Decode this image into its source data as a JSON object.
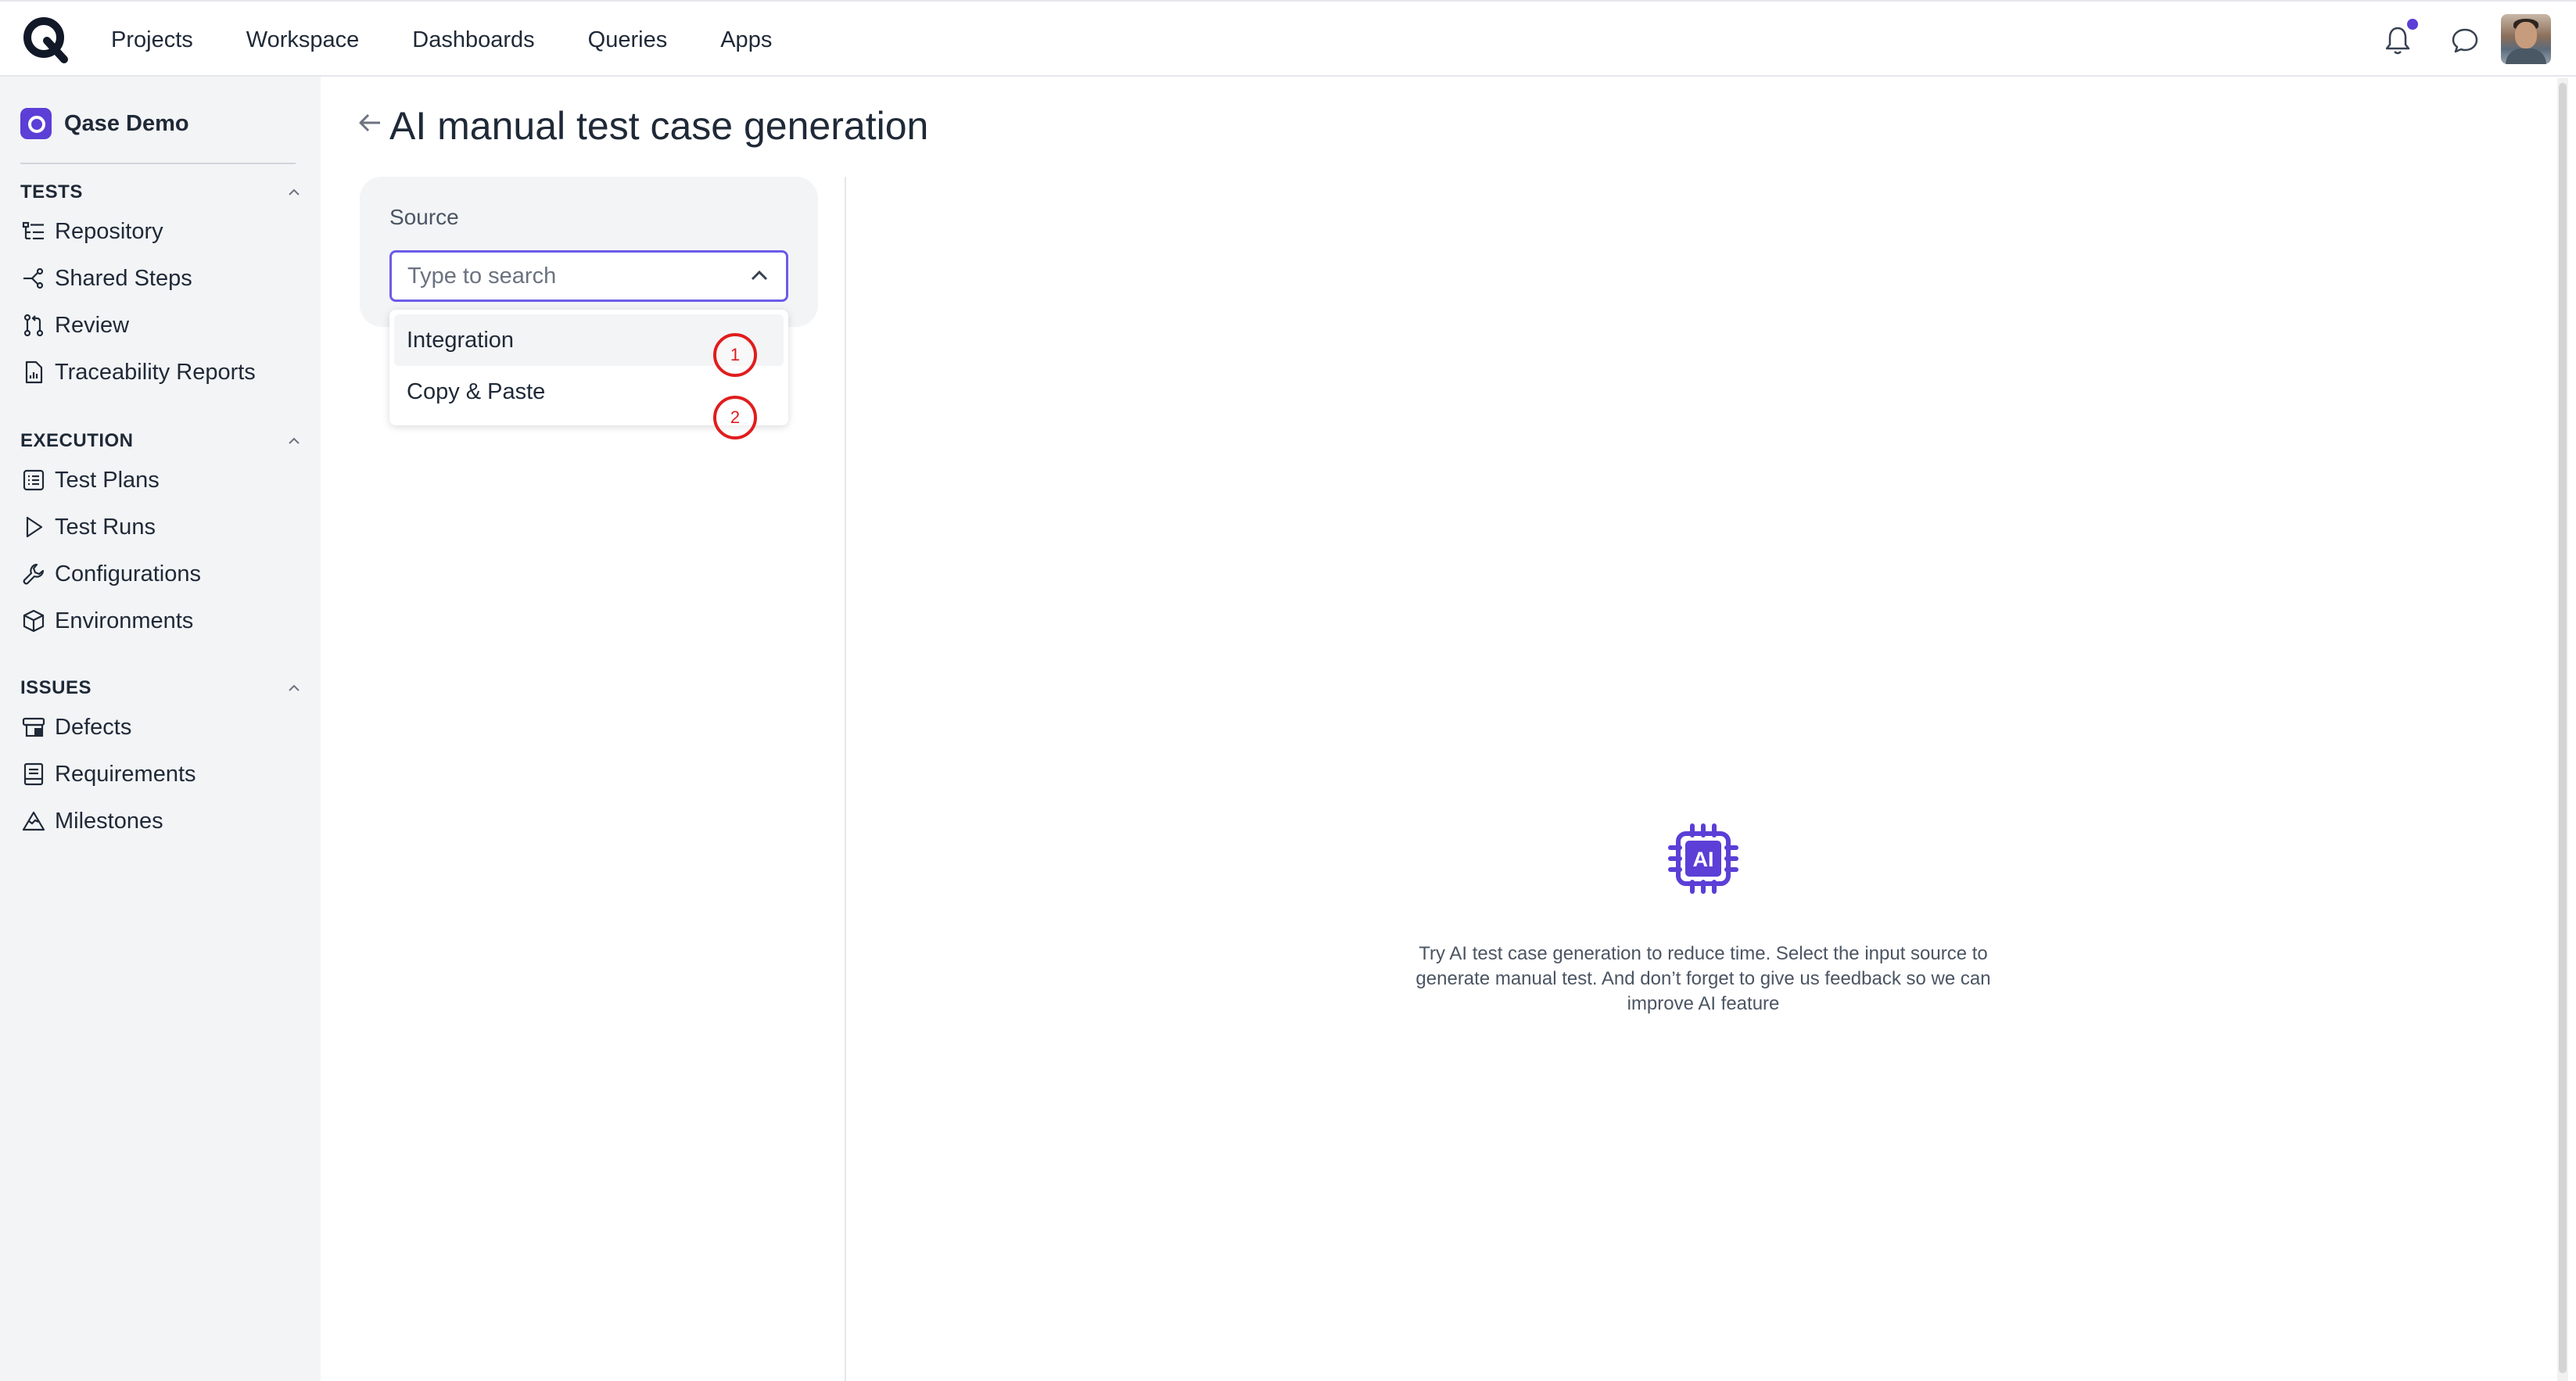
{
  "topnav": {
    "items": [
      "Projects",
      "Workspace",
      "Dashboards",
      "Queries",
      "Apps"
    ],
    "notification_dot_color": "#5b3fd6"
  },
  "sidebar": {
    "project_name": "Qase Demo",
    "sections": [
      {
        "title": "TESTS",
        "items": [
          "Repository",
          "Shared Steps",
          "Review",
          "Traceability Reports"
        ]
      },
      {
        "title": "EXECUTION",
        "items": [
          "Test Plans",
          "Test Runs",
          "Configurations",
          "Environments"
        ]
      },
      {
        "title": "ISSUES",
        "items": [
          "Defects",
          "Requirements",
          "Milestones"
        ]
      }
    ]
  },
  "main": {
    "title": "AI manual test case generation",
    "source_label": "Source",
    "search_placeholder": "Type to search",
    "options": [
      "Integration",
      "Copy & Paste"
    ],
    "markers": [
      "1",
      "2"
    ],
    "empty_state_text": "Try AI test case generation to reduce time. Select the input source to generate manual test. And don’t forget to give us feedback so we can improve AI feature",
    "empty_state_icon": "ai-chip-icon"
  },
  "colors": {
    "accent": "#5b3fd6",
    "focus_border": "#6b5ce7",
    "marker": "#e11d1d"
  }
}
